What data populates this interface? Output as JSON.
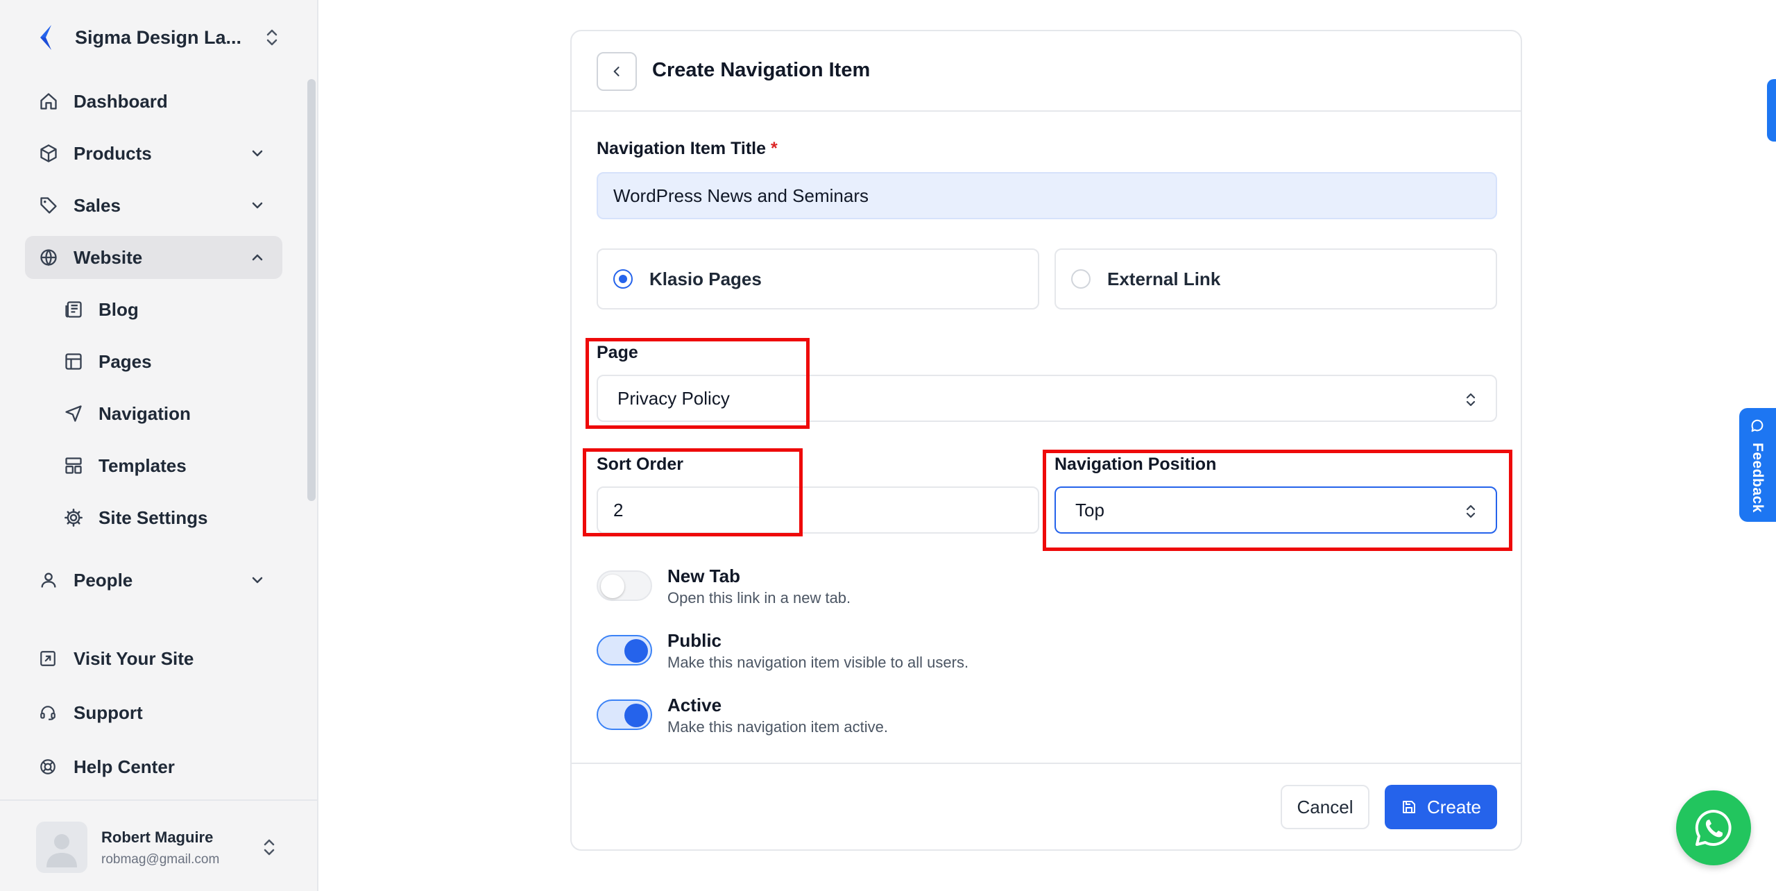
{
  "colors": {
    "accent": "#2563eb",
    "highlight": "#ee0a0a",
    "whatsapp": "#22c55e",
    "feedback": "#1d76f2"
  },
  "sidebar": {
    "team_name": "Sigma Design La...",
    "items": [
      {
        "label": "Dashboard",
        "icon": "home-icon"
      },
      {
        "label": "Products",
        "icon": "box-icon"
      },
      {
        "label": "Sales",
        "icon": "tag-icon"
      },
      {
        "label": "Website",
        "icon": "globe-icon"
      },
      {
        "label": "People",
        "icon": "user-icon"
      }
    ],
    "website_sub": [
      {
        "label": "Blog",
        "icon": "newspaper-icon"
      },
      {
        "label": "Pages",
        "icon": "layout-icon"
      },
      {
        "label": "Navigation",
        "icon": "send-icon"
      },
      {
        "label": "Templates",
        "icon": "templates-icon"
      },
      {
        "label": "Site Settings",
        "icon": "cog-icon"
      }
    ],
    "footer": [
      {
        "label": "Visit Your Site",
        "icon": "external-link-icon"
      },
      {
        "label": "Support",
        "icon": "headset-icon"
      },
      {
        "label": "Help Center",
        "icon": "life-buoy-icon"
      }
    ],
    "user": {
      "name": "Robert Maguire",
      "email": "robmag@gmail.com"
    }
  },
  "form": {
    "title": "Create Navigation Item",
    "nav_title_label": "Navigation Item Title",
    "required_mark": "*",
    "nav_title_value": "WordPress News and Seminars",
    "link_type": {
      "option_pages": "Klasio Pages",
      "option_external": "External Link",
      "selected": "Klasio Pages"
    },
    "page_label": "Page",
    "page_value": "Privacy Policy",
    "sort_label": "Sort Order",
    "sort_value": "2",
    "position_label": "Navigation Position",
    "position_value": "Top",
    "toggles": [
      {
        "title": "New Tab",
        "desc": "Open this link in a new tab.",
        "on": false
      },
      {
        "title": "Public",
        "desc": "Make this navigation item visible to all users.",
        "on": true
      },
      {
        "title": "Active",
        "desc": "Make this navigation item active.",
        "on": true
      }
    ],
    "cancel_label": "Cancel",
    "create_label": "Create"
  },
  "widgets": {
    "feedback_label": "Feedback"
  }
}
